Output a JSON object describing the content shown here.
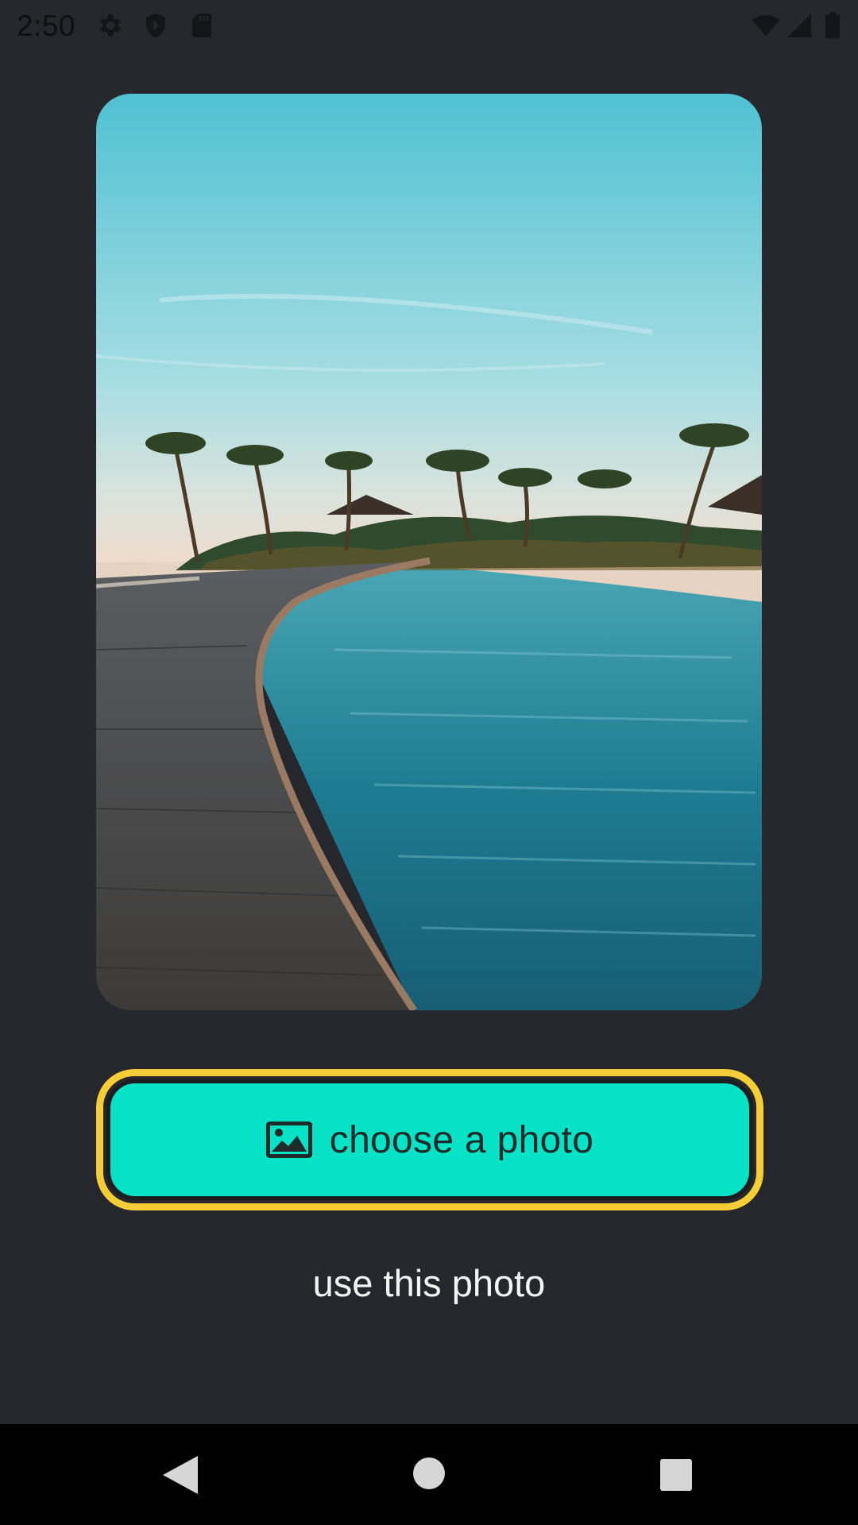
{
  "status_bar": {
    "time": "2:50",
    "left_icons": [
      "gear-icon",
      "shield-icon",
      "sd-card-icon"
    ],
    "right_icons": [
      "wifi-icon",
      "cell-signal-icon",
      "battery-icon"
    ]
  },
  "photo": {
    "subject": "tropical beach photo"
  },
  "choose_button": {
    "label": "choose a photo",
    "icon": "image-icon",
    "fill_color": "#06e2c6",
    "outline_color": "#f5ce37"
  },
  "use_button": {
    "label": "use this photo"
  },
  "nav_bar": {
    "buttons": [
      "back-icon",
      "home-icon",
      "recents-icon"
    ]
  }
}
